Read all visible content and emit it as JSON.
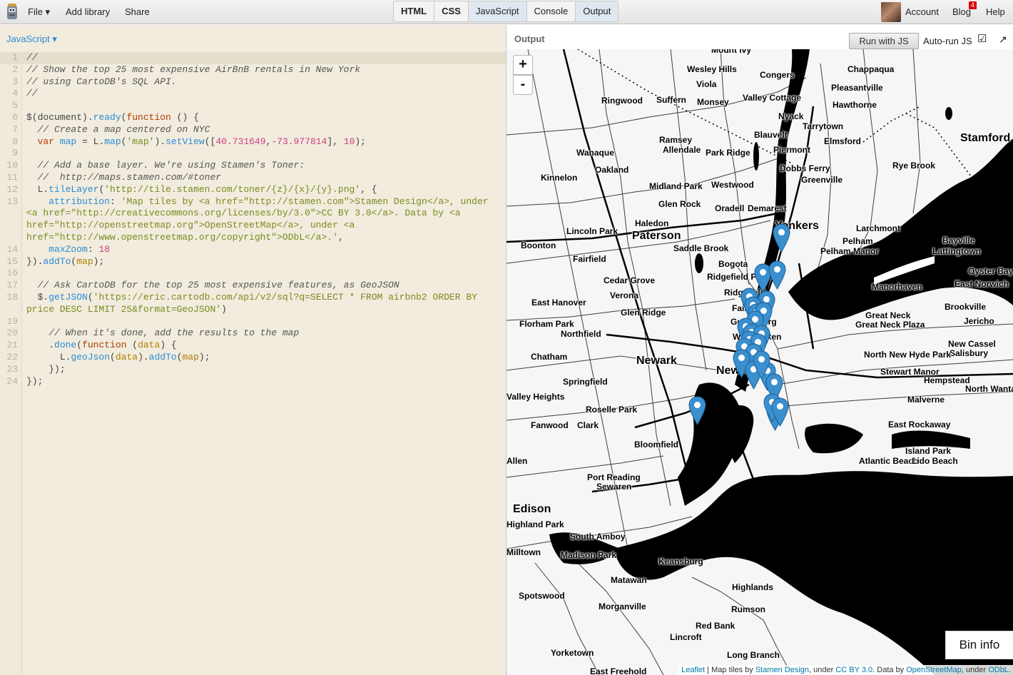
{
  "header": {
    "menu": [
      "File ▾",
      "Add library",
      "Share"
    ],
    "tabs": [
      {
        "label": "HTML",
        "bold": true,
        "active": false
      },
      {
        "label": "CSS",
        "bold": true,
        "active": false
      },
      {
        "label": "JavaScript",
        "bold": false,
        "active": true
      },
      {
        "label": "Console",
        "bold": false,
        "active": false
      },
      {
        "label": "Output",
        "bold": false,
        "active": true
      }
    ],
    "account": "Account",
    "blog": "Blog",
    "blog_badge": "4",
    "help": "Help"
  },
  "editor": {
    "label": "JavaScript ▾",
    "lines": [
      {
        "n": "1",
        "hl": true,
        "t": [
          [
            "c",
            "//"
          ]
        ]
      },
      {
        "n": "2",
        "t": [
          [
            "c",
            "// Show the top 25 most expensive AirBnB rentals in New York"
          ]
        ]
      },
      {
        "n": "3",
        "t": [
          [
            "c",
            "// using CartoDB's SQL API."
          ]
        ]
      },
      {
        "n": "4",
        "t": [
          [
            "c",
            "//"
          ]
        ]
      },
      {
        "n": "5",
        "t": [
          [
            "",
            ""
          ]
        ]
      },
      {
        "n": "6",
        "t": [
          [
            "",
            "$(document)."
          ],
          [
            "p",
            "ready"
          ],
          [
            "",
            "("
          ],
          [
            "k",
            "function"
          ],
          [
            "",
            " () {"
          ]
        ]
      },
      {
        "n": "7",
        "t": [
          [
            "",
            "  "
          ],
          [
            "c",
            "// Create a map centered on NYC"
          ]
        ]
      },
      {
        "n": "8",
        "t": [
          [
            "",
            "  "
          ],
          [
            "k",
            "var"
          ],
          [
            "",
            " "
          ],
          [
            "p",
            "map"
          ],
          [
            "",
            " = L."
          ],
          [
            "p",
            "map"
          ],
          [
            "",
            "("
          ],
          [
            "s",
            "'map'"
          ],
          [
            "",
            ")."
          ],
          [
            "p",
            "setView"
          ],
          [
            "",
            "(["
          ],
          [
            "n",
            "40.731649"
          ],
          [
            "",
            ","
          ],
          [
            "n",
            "-73.977814"
          ],
          [
            "",
            "], "
          ],
          [
            "n",
            "10"
          ],
          [
            "",
            ");"
          ]
        ]
      },
      {
        "n": "9",
        "t": [
          [
            "",
            ""
          ]
        ]
      },
      {
        "n": "10",
        "t": [
          [
            "",
            "  "
          ],
          [
            "c",
            "// Add a base layer. We're using Stamen's Toner:"
          ]
        ]
      },
      {
        "n": "11",
        "t": [
          [
            "",
            "  "
          ],
          [
            "c",
            "//  http://maps.stamen.com/#toner"
          ]
        ]
      },
      {
        "n": "12",
        "t": [
          [
            "",
            "  L."
          ],
          [
            "p",
            "tileLayer"
          ],
          [
            "",
            "("
          ],
          [
            "s",
            "'http://tile.stamen.com/toner/{z}/{x}/{y}.png'"
          ],
          [
            "",
            ", {"
          ]
        ]
      },
      {
        "n": "13",
        "t": [
          [
            "",
            "    "
          ],
          [
            "p",
            "attribution"
          ],
          [
            "",
            ": "
          ],
          [
            "s",
            "'Map tiles by <a href=\"http://stamen.com\">Stamen Design</a>, under <a href=\"http://creativecommons.org/licenses/by/3.0\">CC BY 3.0</a>. Data by <a href=\"http://openstreetmap.org\">OpenStreetMap</a>, under <a href=\"http://www.openstreetmap.org/copyright\">ODbL</a>.'"
          ],
          [
            "",
            ","
          ]
        ]
      },
      {
        "n": "14",
        "t": [
          [
            "",
            "    "
          ],
          [
            "p",
            "maxZoom"
          ],
          [
            "",
            ": "
          ],
          [
            "n",
            "18"
          ]
        ]
      },
      {
        "n": "15",
        "t": [
          [
            "",
            "})."
          ],
          [
            "p",
            "addTo"
          ],
          [
            "",
            "("
          ],
          [
            "v",
            "map"
          ],
          [
            "",
            ");"
          ]
        ]
      },
      {
        "n": "16",
        "t": [
          [
            "",
            ""
          ]
        ]
      },
      {
        "n": "17",
        "t": [
          [
            "",
            "  "
          ],
          [
            "c",
            "// Ask CartoDB for the top 25 most expensive features, as GeoJSON"
          ]
        ]
      },
      {
        "n": "18",
        "t": [
          [
            "",
            "  $."
          ],
          [
            "p",
            "getJSON"
          ],
          [
            "",
            "("
          ],
          [
            "s",
            "'https://eric.cartodb.com/api/v2/sql?q=SELECT * FROM airbnb2 ORDER BY price DESC LIMIT 25&format=GeoJSON'"
          ],
          [
            "",
            ")"
          ]
        ]
      },
      {
        "n": "19",
        "t": [
          [
            "",
            ""
          ]
        ]
      },
      {
        "n": "20",
        "t": [
          [
            "",
            "    "
          ],
          [
            "c",
            "// When it's done, add the results to the map"
          ]
        ]
      },
      {
        "n": "21",
        "t": [
          [
            "",
            "    ."
          ],
          [
            "p",
            "done"
          ],
          [
            "",
            "("
          ],
          [
            "k",
            "function"
          ],
          [
            "",
            " ("
          ],
          [
            "v",
            "data"
          ],
          [
            "",
            ") {"
          ]
        ]
      },
      {
        "n": "22",
        "t": [
          [
            "",
            "      L."
          ],
          [
            "p",
            "geoJson"
          ],
          [
            "",
            "("
          ],
          [
            "v",
            "data"
          ],
          [
            "",
            ")."
          ],
          [
            "p",
            "addTo"
          ],
          [
            "",
            "("
          ],
          [
            "v",
            "map"
          ],
          [
            "",
            ");"
          ]
        ]
      },
      {
        "n": "23",
        "t": [
          [
            "",
            "    });"
          ]
        ]
      },
      {
        "n": "24",
        "t": [
          [
            "",
            "});"
          ]
        ]
      }
    ]
  },
  "output": {
    "label": "Output",
    "run_button": "Run with JS",
    "autorun_label": "Auto-run JS",
    "autorun_checked": true,
    "popout_icon": "popout-arrow-icon",
    "zoom_in": "+",
    "zoom_out": "-",
    "bin_info": "Bin info",
    "attribution": [
      {
        "text": "Leaflet",
        "link": true
      },
      {
        "text": " | Map tiles by ",
        "link": false
      },
      {
        "text": "Stamen Design",
        "link": true
      },
      {
        "text": ", under ",
        "link": false
      },
      {
        "text": "CC BY 3.0",
        "link": true
      },
      {
        "text": ". Data by ",
        "link": false
      },
      {
        "text": "OpenStreetMap",
        "link": true
      },
      {
        "text": ", under ",
        "link": false
      },
      {
        "text": "ODbL",
        "link": true
      },
      {
        "text": ".",
        "link": false
      }
    ],
    "marker_color": "#3a8fcf",
    "marker_count": 25,
    "place_labels": [
      "Mount Ivy",
      "Wesley Hills",
      "Congers",
      "Chappaqua",
      "Viola",
      "Pleasantville",
      "Ringwood",
      "Suffern",
      "Monsey",
      "Valley Cottage",
      "Hawthorne",
      "Nyack",
      "Tarrytown",
      "Ramsey",
      "Allendale",
      "Blauvelt",
      "Elmsford",
      "Stamford",
      "Wanaque",
      "Park Ridge",
      "Piermont",
      "Oakland",
      "Dobbs Ferry",
      "Rye Brook",
      "Kinnelon",
      "Greenville",
      "Midland Park",
      "Westwood",
      "Glen Rock",
      "Oradell",
      "Demarest",
      "Haledon",
      "Yonkers",
      "Larchmont",
      "Lincoln Park",
      "Paterson",
      "Bayville",
      "Boonton",
      "Saddle Brook",
      "Pelham",
      "Pelham Manor",
      "Lattingtown",
      "Fairfield",
      "Bogota",
      "Oyster Bay",
      "Ridgefield Park",
      "Cedar Grove",
      "East Norwich",
      "Ridgefield",
      "Verona",
      "Manorhaven",
      "East Hanover",
      "Fairview",
      "Glen Ridge",
      "Brookville",
      "Guttenberg",
      "Great Neck",
      "Florham Park",
      "Great Neck Plaza",
      "Jericho",
      "Northfield",
      "Weehawken",
      "New Cassel",
      "Salisbury",
      "Chatham",
      "Newark",
      "North New Hyde Park",
      "New York",
      "Stewart Manor",
      "Hempstead",
      "Springfield",
      "North Wantagh",
      "Valley Heights",
      "Malverne",
      "Roselle Park",
      "Fanwood",
      "Clark",
      "East Rockaway",
      "Bloomfield",
      "Island Park",
      "Allen",
      "Atlantic Beach",
      "Lido Beach",
      "Port Reading",
      "Sewaren",
      "Edison",
      "Highland Park",
      "South Amboy",
      "Milltown",
      "Madison Park",
      "Keansburg",
      "Matawan",
      "Spotswood",
      "Highlands",
      "Morganville",
      "Rumson",
      "Red Bank",
      "Lincroft",
      "Yorketown",
      "Long Branch",
      "East Freehold"
    ]
  }
}
